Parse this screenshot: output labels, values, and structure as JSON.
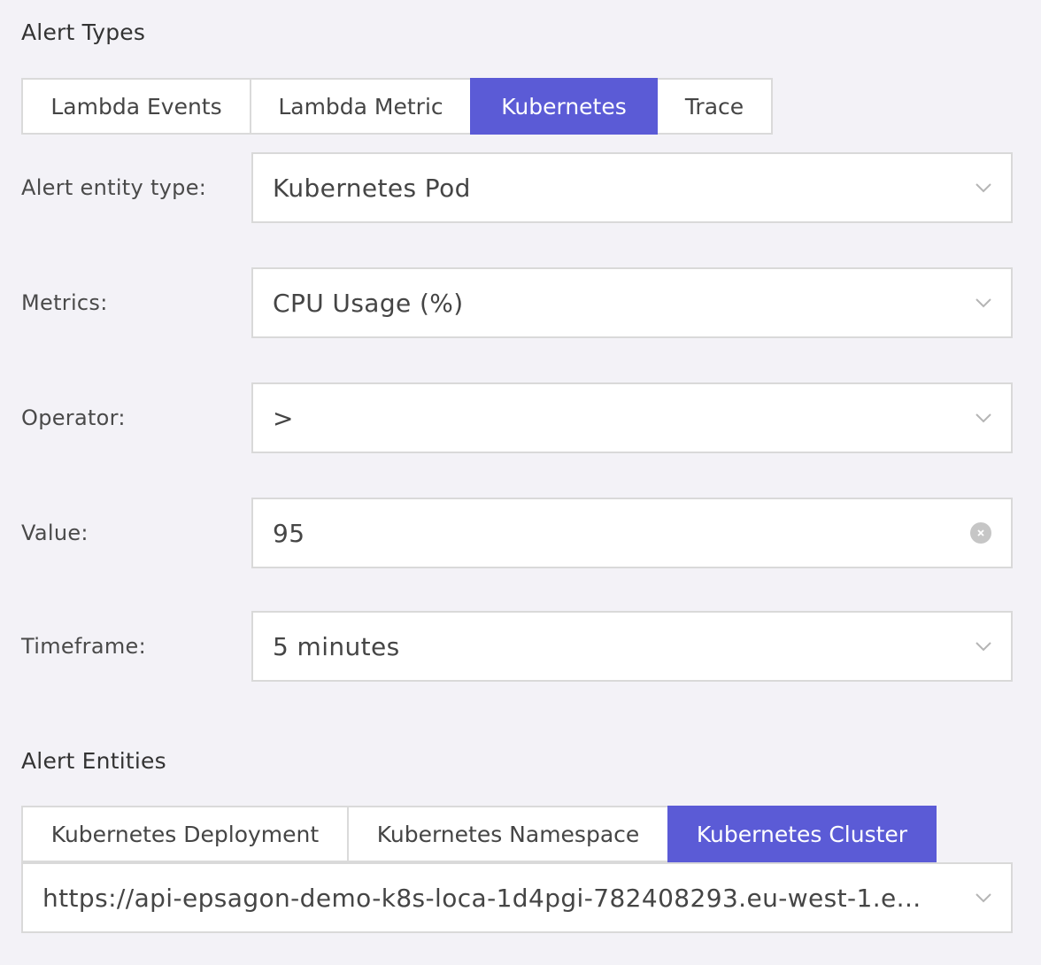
{
  "alert_types": {
    "title": "Alert Types",
    "tabs": [
      {
        "label": "Lambda Events",
        "active": false
      },
      {
        "label": "Lambda Metric",
        "active": false
      },
      {
        "label": "Kubernetes",
        "active": true
      },
      {
        "label": "Trace",
        "active": false
      }
    ]
  },
  "form": {
    "entity_type": {
      "label": "Alert entity type:",
      "value": "Kubernetes Pod"
    },
    "metrics": {
      "label": "Metrics:",
      "value": "CPU Usage (%)"
    },
    "operator": {
      "label": "Operator:",
      "value": ">"
    },
    "value": {
      "label": "Value:",
      "value": "95"
    },
    "timeframe": {
      "label": "Timeframe:",
      "value": "5 minutes"
    }
  },
  "alert_entities": {
    "title": "Alert Entities",
    "tabs": [
      {
        "label": "Kubernetes Deployment",
        "active": false
      },
      {
        "label": "Kubernetes Namespace",
        "active": false
      },
      {
        "label": "Kubernetes Cluster",
        "active": true
      }
    ],
    "selected": "https://api-epsagon-demo-k8s-loca-1d4pgi-782408293.eu-west-1.e..."
  },
  "icons": {
    "dropdown": "chevron-down-icon",
    "clear": "clear-circle-icon"
  },
  "colors": {
    "accent": "#5b5bd6",
    "background": "#f3f2f7",
    "border": "#d9d9d9"
  }
}
